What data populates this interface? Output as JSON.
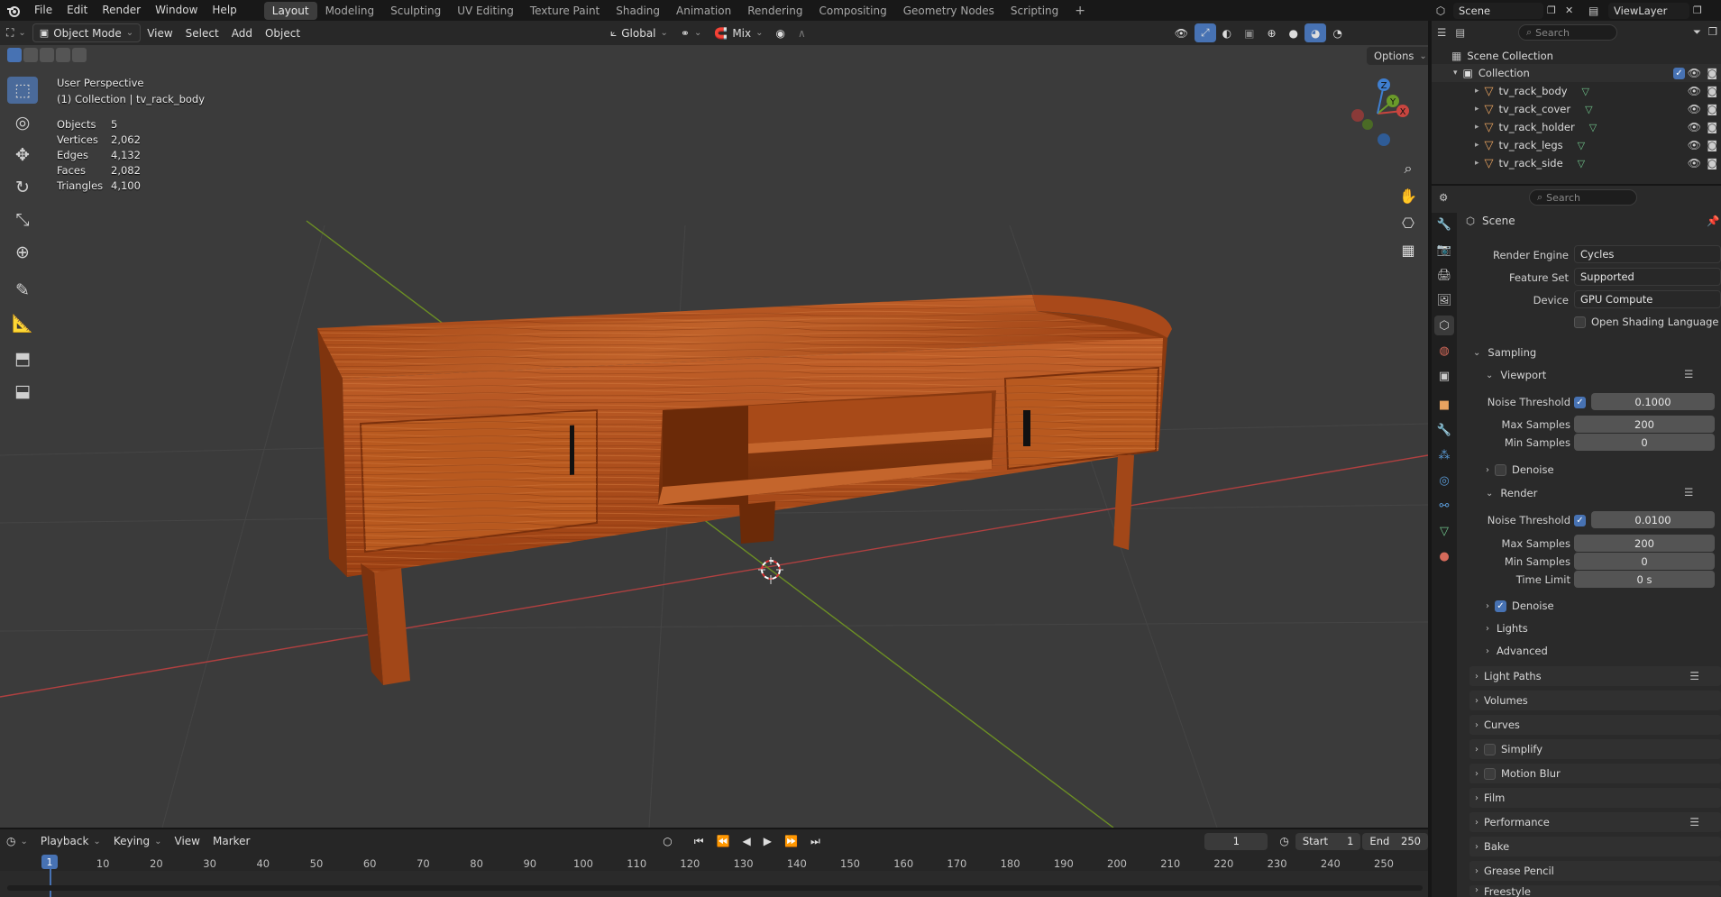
{
  "menu": [
    "File",
    "Edit",
    "Render",
    "Window",
    "Help"
  ],
  "workspaces": [
    "Layout",
    "Modeling",
    "Sculpting",
    "UV Editing",
    "Texture Paint",
    "Shading",
    "Animation",
    "Rendering",
    "Compositing",
    "Geometry Nodes",
    "Scripting"
  ],
  "scene_name": "Scene",
  "view_layer": "ViewLayer",
  "viewport_header": {
    "mode": "Object Mode",
    "view": "View",
    "select": "Select",
    "add": "Add",
    "object": "Object",
    "orientation": "Global",
    "pivot": "Mix",
    "options": "Options"
  },
  "overlay": {
    "perspective": "User Perspective",
    "collection": "(1) Collection | tv_rack_body",
    "stats": [
      {
        "label": "Objects",
        "value": "5"
      },
      {
        "label": "Vertices",
        "value": "2,062"
      },
      {
        "label": "Edges",
        "value": "4,132"
      },
      {
        "label": "Faces",
        "value": "2,082"
      },
      {
        "label": "Triangles",
        "value": "4,100"
      }
    ]
  },
  "gizmo": {
    "x": "X",
    "y": "Y",
    "z": "Z"
  },
  "outliner": {
    "search_placeholder": "Search",
    "scene_collection": "Scene Collection",
    "collection": "Collection",
    "objects": [
      "tv_rack_body",
      "tv_rack_cover",
      "tv_rack_holder",
      "tv_rack_legs",
      "tv_rack_side"
    ]
  },
  "properties": {
    "search_placeholder": "Search",
    "context": "Scene",
    "render_engine_label": "Render Engine",
    "render_engine": "Cycles",
    "feature_set_label": "Feature Set",
    "feature_set": "Supported",
    "device_label": "Device",
    "device": "GPU Compute",
    "osl": "Open Shading Language",
    "sampling": "Sampling",
    "viewport": "Viewport",
    "vp_noise_label": "Noise Threshold",
    "vp_noise": "0.1000",
    "vp_max_label": "Max Samples",
    "vp_max": "200",
    "vp_min_label": "Min Samples",
    "vp_min": "0",
    "vp_denoise": "Denoise",
    "render": "Render",
    "r_noise_label": "Noise Threshold",
    "r_noise": "0.0100",
    "r_max_label": "Max Samples",
    "r_max": "200",
    "r_min_label": "Min Samples",
    "r_min": "0",
    "r_time_label": "Time Limit",
    "r_time": "0 s",
    "r_denoise": "Denoise",
    "lights": "Lights",
    "advanced": "Advanced",
    "panels": [
      "Light Paths",
      "Volumes",
      "Curves",
      "Simplify",
      "Motion Blur",
      "Film",
      "Performance",
      "Bake",
      "Grease Pencil",
      "Freestyle"
    ]
  },
  "timeline": {
    "playback": "Playback",
    "keying": "Keying",
    "view": "View",
    "marker": "Marker",
    "current_frame": "1",
    "start_label": "Start",
    "start": "1",
    "end_label": "End",
    "end": "250",
    "ticks": [
      "10",
      "20",
      "30",
      "40",
      "50",
      "60",
      "70",
      "80",
      "90",
      "100",
      "110",
      "120",
      "130",
      "140",
      "150",
      "160",
      "170",
      "180",
      "190",
      "200",
      "210",
      "220",
      "230",
      "240",
      "250"
    ],
    "playhead": "1"
  },
  "colors": {
    "accent": "#4772b3",
    "wood": "#b4531d",
    "x_axis": "#c9453f",
    "y_axis": "#6a9a2a",
    "z_axis": "#3f7fd0"
  }
}
